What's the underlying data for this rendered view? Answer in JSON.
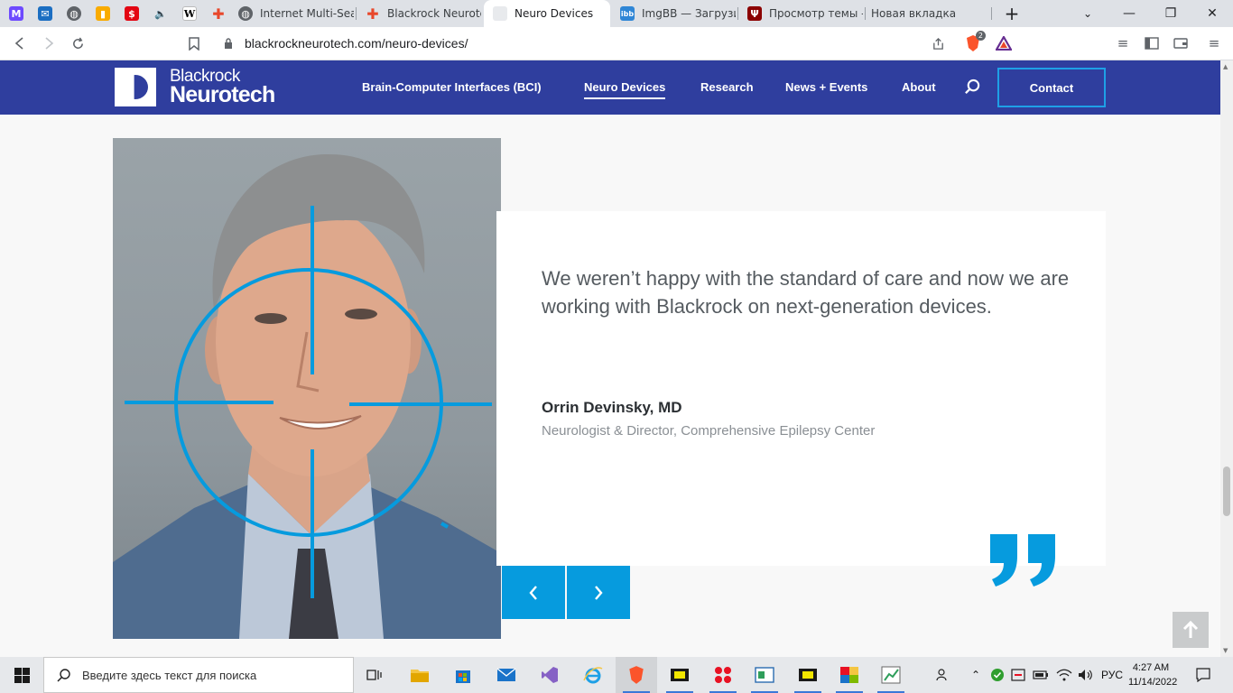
{
  "browser": {
    "tabs": [
      {
        "title": "Internet Multi-Search",
        "active": false
      },
      {
        "title": "Blackrock Neurotech",
        "active": false
      },
      {
        "title": "Neuro Devices",
        "active": true
      },
      {
        "title": "ImgBB — Загрузить",
        "active": false
      },
      {
        "title": "Просмотр темы - G",
        "active": false
      },
      {
        "title": "Новая вкладка",
        "active": false
      }
    ],
    "url": "blackrockneurotech.com/neuro-devices/",
    "shield_count": "2"
  },
  "site": {
    "logo_line1": "Blackrock",
    "logo_line2": "Neurotech",
    "nav": [
      {
        "label": "Brain-Computer Interfaces (BCI)"
      },
      {
        "label": "Neuro Devices"
      },
      {
        "label": "Research"
      },
      {
        "label": "News + Events"
      },
      {
        "label": "About"
      }
    ],
    "contact_label": "Contact"
  },
  "testimonial": {
    "quote": "We weren’t happy with the standard of care and now we are working with Blackrock on next-generation devices.",
    "name": "Orrin Devinsky, MD",
    "role": "Neurologist & Director, Comprehensive Epilepsy Center"
  },
  "taskbar": {
    "search_placeholder": "Введите здесь текст для поиска",
    "lang": "РУС",
    "time": "4:27 AM",
    "date": "11/14/2022"
  },
  "colors": {
    "brand": "#2f3e9e",
    "accent": "#069bde"
  }
}
